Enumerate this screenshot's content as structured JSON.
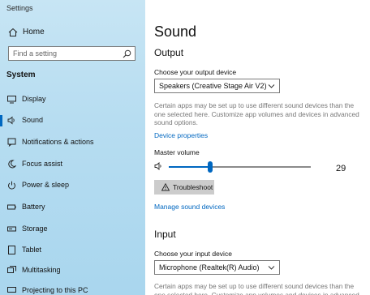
{
  "window": {
    "title": "Settings"
  },
  "sidebar": {
    "home_label": "Home",
    "search_placeholder": "Find a setting",
    "section_label": "System",
    "items": [
      {
        "label": "Display",
        "icon": "display-icon"
      },
      {
        "label": "Sound",
        "icon": "speaker-icon",
        "active": true
      },
      {
        "label": "Notifications & actions",
        "icon": "notifications-icon"
      },
      {
        "label": "Focus assist",
        "icon": "moon-icon"
      },
      {
        "label": "Power & sleep",
        "icon": "power-icon"
      },
      {
        "label": "Battery",
        "icon": "battery-icon"
      },
      {
        "label": "Storage",
        "icon": "storage-icon"
      },
      {
        "label": "Tablet",
        "icon": "tablet-icon"
      },
      {
        "label": "Multitasking",
        "icon": "multitasking-icon"
      },
      {
        "label": "Projecting to this PC",
        "icon": "projector-icon"
      }
    ]
  },
  "main": {
    "title": "Sound",
    "output": {
      "heading": "Output",
      "device_label": "Choose your output device",
      "device_value": "Speakers (Creative Stage Air V2)",
      "description": "Certain apps may be set up to use different sound devices than the one selected here. Customize app volumes and devices in advanced sound options.",
      "device_properties_link": "Device properties",
      "master_volume_label": "Master volume",
      "volume": 29,
      "volume_display": "29",
      "troubleshoot_label": "Troubleshoot",
      "manage_link": "Manage sound devices"
    },
    "input": {
      "heading": "Input",
      "device_label": "Choose your input device",
      "device_value": "Microphone (Realtek(R) Audio)",
      "description": "Certain apps may be set up to use different sound devices than the one selected here. Customize app volumes and devices in advanced sound options."
    }
  },
  "colors": {
    "accent": "#0067c0",
    "sidebar_bg": "#b7ddf1"
  }
}
